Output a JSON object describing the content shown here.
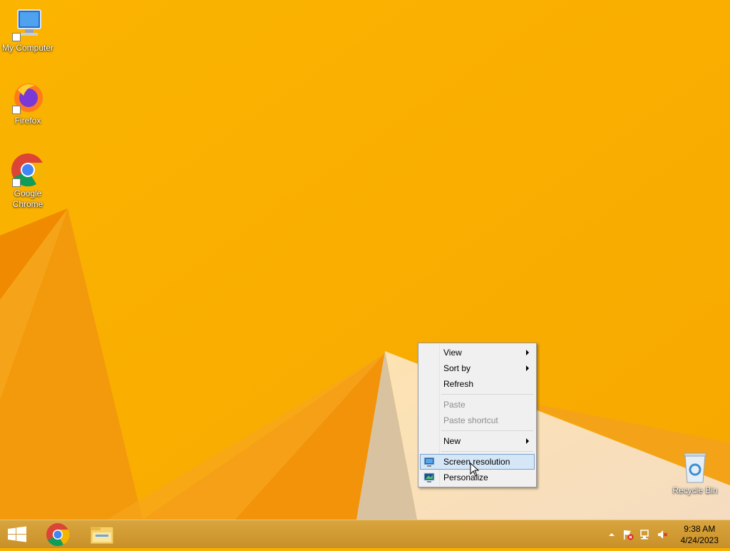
{
  "desktop": {
    "icons": [
      {
        "label": "My Computer",
        "icon": "computer-icon"
      },
      {
        "label": "Firefox",
        "icon": "firefox-icon"
      },
      {
        "label": "Google Chrome",
        "icon": "chrome-icon"
      },
      {
        "label": "Recycle Bin",
        "icon": "recycle-bin-icon"
      }
    ]
  },
  "context_menu": {
    "items": [
      {
        "label": "View",
        "submenu": true,
        "enabled": true
      },
      {
        "label": "Sort by",
        "submenu": true,
        "enabled": true
      },
      {
        "label": "Refresh",
        "enabled": true
      },
      {
        "label": "Paste",
        "enabled": false
      },
      {
        "label": "Paste shortcut",
        "enabled": false
      },
      {
        "label": "New",
        "submenu": true,
        "enabled": true
      },
      {
        "label": "Screen resolution",
        "enabled": true,
        "highlighted": true,
        "icon": "screen-resolution-icon"
      },
      {
        "label": "Personalize",
        "enabled": true,
        "icon": "personalize-icon"
      }
    ]
  },
  "taskbar": {
    "pinned": [
      {
        "name": "Start",
        "icon": "windows-start-icon"
      },
      {
        "name": "Google Chrome",
        "icon": "chrome-icon"
      },
      {
        "name": "File Explorer",
        "icon": "file-explorer-icon"
      }
    ],
    "tray": [
      "show-hidden-icons-icon",
      "action-center-flag-icon",
      "network-icon",
      "speaker-muted-icon"
    ],
    "clock": {
      "time": "9:38 AM",
      "date": "4/24/2023"
    }
  },
  "colors": {
    "accent": "#f9b000",
    "menu_highlight": "#d5e6f7",
    "taskbar": "#cf9a30"
  }
}
